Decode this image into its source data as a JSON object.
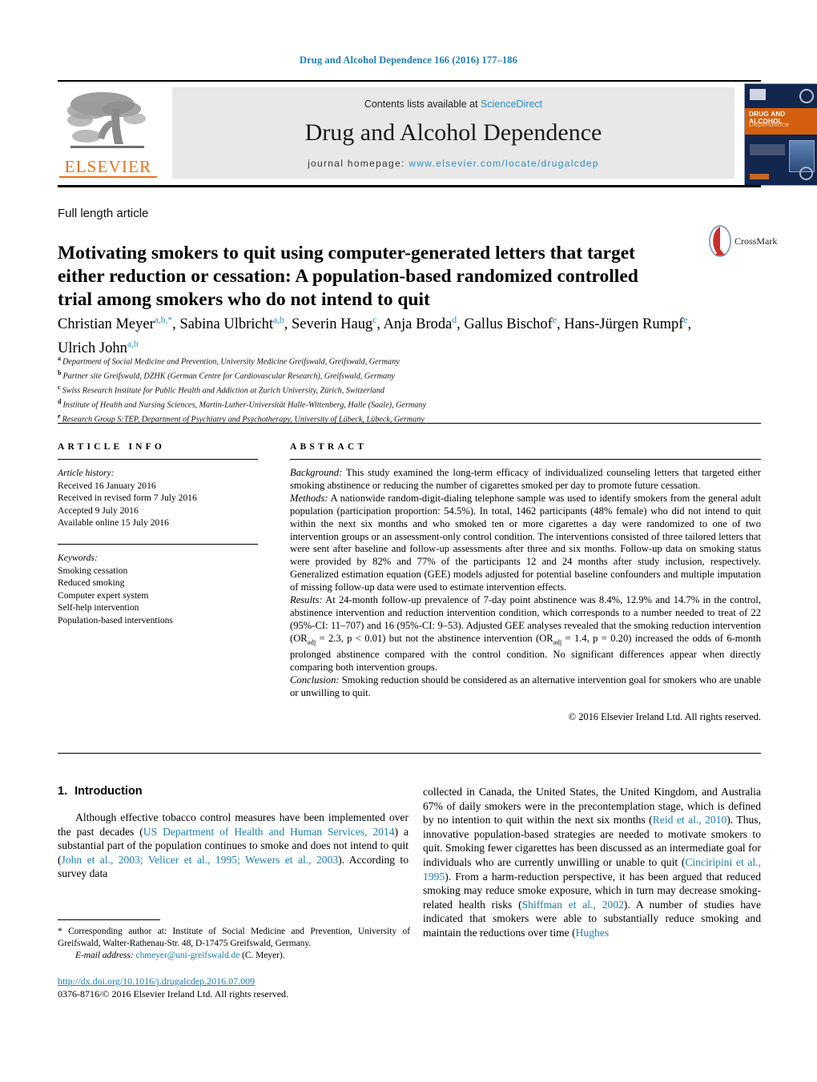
{
  "running_head": "Drug and Alcohol Dependence 166 (2016) 177–186",
  "masthead": {
    "contents_prefix": "Contents lists available at ",
    "contents_link": "ScienceDirect",
    "journal_title": "Drug and Alcohol Dependence",
    "homepage_label": "journal homepage:",
    "homepage_url": "www.elsevier.com/locate/drugalcdep",
    "publisher_wordmark": "ELSEVIER",
    "cover_title_line1": "DRUG AND ALCOHOL",
    "cover_title_line2": "Dependence"
  },
  "article": {
    "type": "Full length article",
    "title": "Motivating smokers to quit using computer-generated letters that target either reduction or cessation: A population-based randomized controlled trial among smokers who do not intend to quit",
    "crossmark_label": "CrossMark"
  },
  "authors": {
    "list": [
      {
        "name": "Christian Meyer",
        "sup": "a,b,*"
      },
      {
        "name": "Sabina Ulbricht",
        "sup": "a,b"
      },
      {
        "name": "Severin Haug",
        "sup": "c"
      },
      {
        "name": "Anja Broda",
        "sup": "d"
      },
      {
        "name": "Gallus Bischof",
        "sup": "e"
      },
      {
        "name": "Hans-Jürgen Rumpf",
        "sup": "e"
      },
      {
        "name": "Ulrich John",
        "sup": "a,b"
      }
    ]
  },
  "affiliations": [
    {
      "label": "a",
      "text": "Department of Social Medicine and Prevention, University Medicine Greifswald, Greifswald, Germany"
    },
    {
      "label": "b",
      "text": "Partner site Greifswald, DZHK (German Centre for Cardiovascular Research), Greifswald, Germany"
    },
    {
      "label": "c",
      "text": "Swiss Research Institute for Public Health and Addiction at Zurich University, Zürich, Switzerland"
    },
    {
      "label": "d",
      "text": "Institute of Health and Nursing Sciences, Martin-Luther-Universität Halle-Wittenberg, Halle (Saale), Germany"
    },
    {
      "label": "e",
      "text": "Research Group S:TEP, Department of Psychiatry and Psychotherapy, University of Lübeck, Lübeck, Germany"
    }
  ],
  "article_info": {
    "heading": "ARTICLE INFO",
    "history_title": "Article history:",
    "history": [
      "Received 16 January 2016",
      "Received in revised form 7 July 2016",
      "Accepted 9 July 2016",
      "Available online 15 July 2016"
    ],
    "keywords_title": "Keywords:",
    "keywords": [
      "Smoking cessation",
      "Reduced smoking",
      "Computer expert system",
      "Self-help intervention",
      "Population-based interventions"
    ]
  },
  "abstract": {
    "heading": "ABSTRACT",
    "background_label": "Background:",
    "background": "This study examined the long-term efficacy of individualized counseling letters that targeted either smoking abstinence or reducing the number of cigarettes smoked per day to promote future cessation.",
    "methods_label": "Methods:",
    "methods": "A nationwide random-digit-dialing telephone sample was used to identify smokers from the general adult population (participation proportion: 54.5%). In total, 1462 participants (48% female) who did not intend to quit within the next six months and who smoked ten or more cigarettes a day were randomized to one of two intervention groups or an assessment-only control condition. The interventions consisted of three tailored letters that were sent after baseline and follow-up assessments after three and six months. Follow-up data on smoking status were provided by 82% and 77% of the participants 12 and 24 months after study inclusion, respectively. Generalized estimation equation (GEE) models adjusted for potential baseline confounders and multiple imputation of missing follow-up data were used to estimate intervention effects.",
    "results_label": "Results:",
    "results_part1": "At 24-month follow-up prevalence of 7-day point abstinence was 8.4%, 12.9% and 14.7% in the control, abstinence intervention and reduction intervention condition, which corresponds to a number needed to treat of 22 (95%-CI: 11–707) and 16 (95%-CI: 9–53). Adjusted GEE analyses revealed that the smoking reduction intervention (OR",
    "results_sub1": "adj",
    "results_part2": " = 2.3, p < 0.01) but not the abstinence intervention (OR",
    "results_sub2": "adj",
    "results_part3": " = 1.4, p = 0.20) increased the odds of 6-month prolonged abstinence compared with the control condition. No significant differences appear when directly comparing both intervention groups.",
    "conclusion_label": "Conclusion:",
    "conclusion": "Smoking reduction should be considered as an alternative intervention goal for smokers who are unable or unwilling to quit.",
    "copyright": "© 2016 Elsevier Ireland Ltd. All rights reserved."
  },
  "introduction": {
    "number": "1.",
    "heading": "Introduction",
    "left_p1_a": "Although effective tobacco control measures have been implemented over the past decades (",
    "left_ref1": "US Department of Health and Human Services, 2014",
    "left_p1_b": ") a substantial part of the population continues to smoke and does not intend to quit (",
    "left_ref2": "John et al., 2003; Velicer et al., 1995; Wewers et al., 2003",
    "left_p1_c": "). According to survey data",
    "right_a": "collected in Canada, the United States, the United Kingdom, and Australia 67% of daily smokers were in the precontemplation stage, which is defined by no intention to quit within the next six months (",
    "right_ref1": "Reid et al., 2010",
    "right_b": "). Thus, innovative population-based strategies are needed to motivate smokers to quit. Smoking fewer cigarettes has been discussed as an intermediate goal for individuals who are currently unwilling or unable to quit (",
    "right_ref2": "Cinciripini et al., 1995",
    "right_c": "). From a harm-reduction perspective, it has been argued that reduced smoking may reduce smoke exposure, which in turn may decrease smoking-related health risks (",
    "right_ref3": "Shiffman et al., 2002",
    "right_d": "). A number of studies have indicated that smokers were able to substantially reduce smoking and maintain the reductions over time (",
    "right_ref4": "Hughes"
  },
  "footnote": {
    "star": "*",
    "corresponding_text": " Corresponding author at: Institute of Social Medicine and Prevention, University of Greifswald, Walter-Rathenau-Str. 48, D-17475 Greifswald, Germany.",
    "email_label": "E-mail address:",
    "email": "chmeyer@uni-greifswald.de",
    "email_suffix": " (C. Meyer)."
  },
  "footer": {
    "doi": "http://dx.doi.org/10.1016/j.drugalcdep.2016.07.009",
    "issn_line": "0376-8716/© 2016 Elsevier Ireland Ltd. All rights reserved."
  },
  "colors": {
    "link_blue": "#1c7eb5",
    "elsevier_orange": "#E9711C",
    "band_gray": "#e8e8e8",
    "cover_navy": "#12264e"
  }
}
